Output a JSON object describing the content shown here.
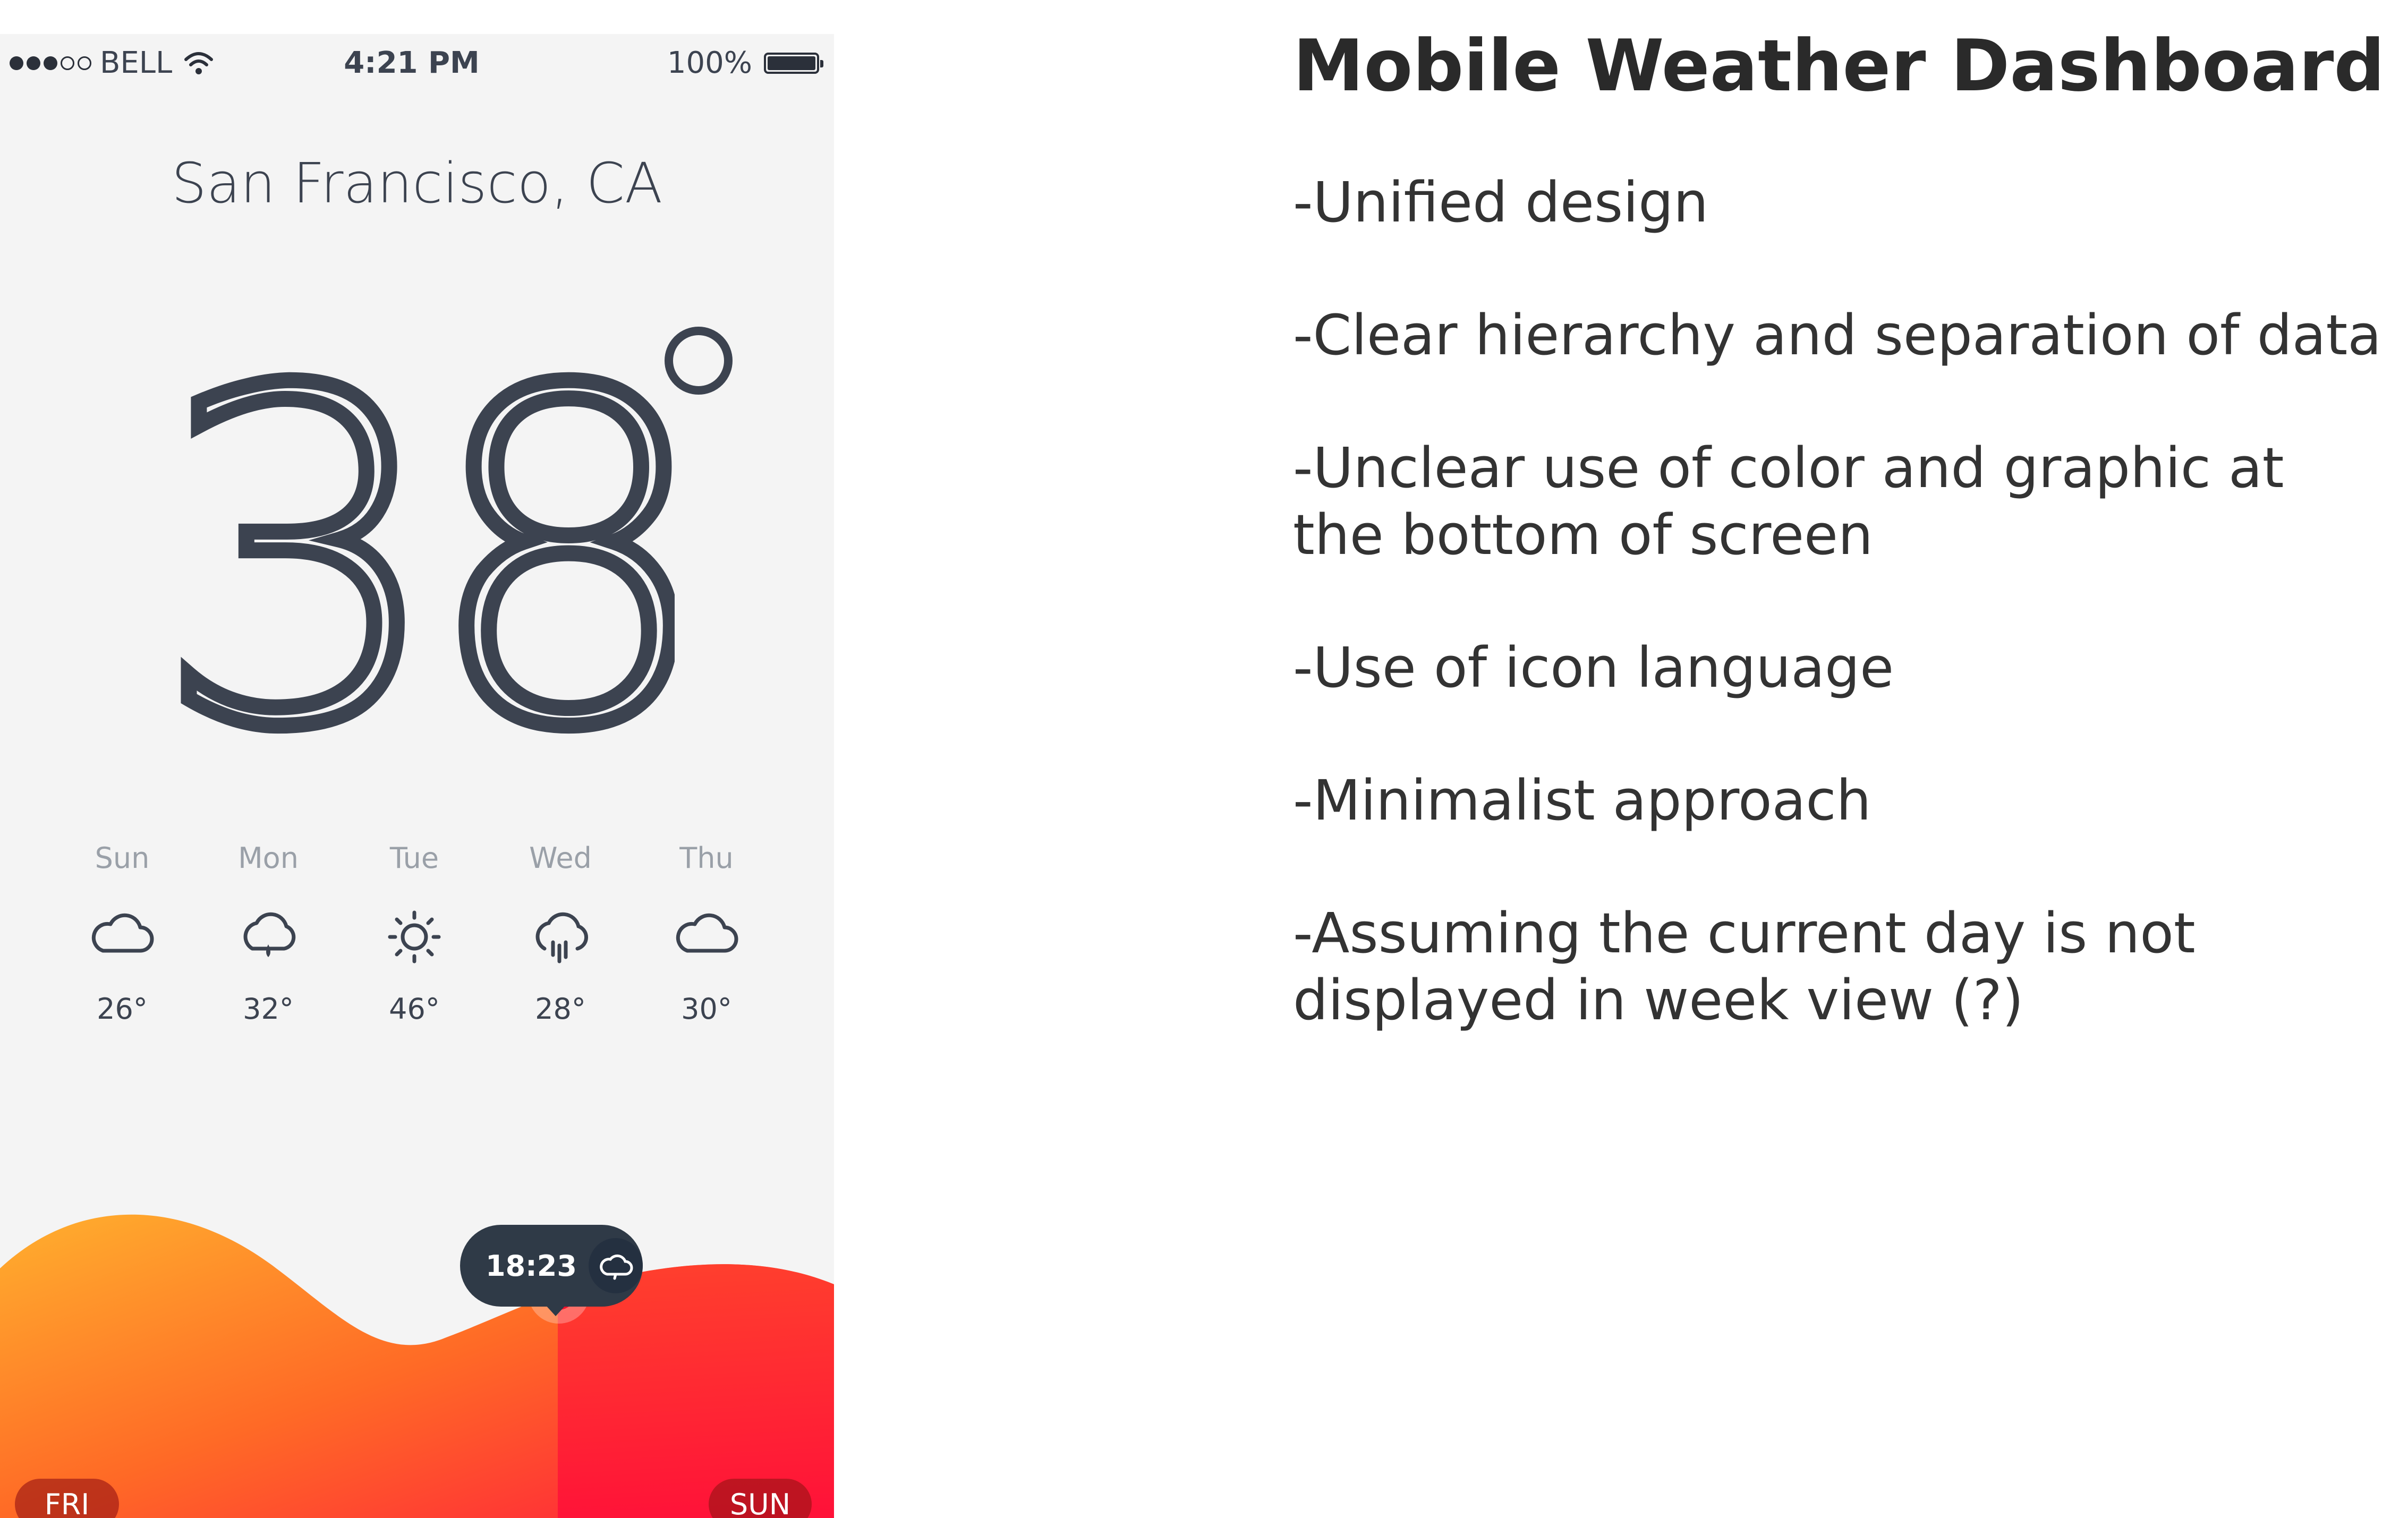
{
  "phone": {
    "status_bar": {
      "carrier": "BELL",
      "time": "4:21 PM",
      "battery": "100%",
      "signal_bars": 3,
      "signal_max": 5
    },
    "city": "San Francisco, CA",
    "current_temp": "38",
    "forecast": [
      {
        "day": "Sun",
        "icon": "cloud-icon",
        "temp": "26°"
      },
      {
        "day": "Mon",
        "icon": "cloud-rain-drop-icon",
        "temp": "32°"
      },
      {
        "day": "Tue",
        "icon": "sun-icon",
        "temp": "46°"
      },
      {
        "day": "Wed",
        "icon": "cloud-heavy-rain-icon",
        "temp": "28°"
      },
      {
        "day": "Thu",
        "icon": "cloud-icon",
        "temp": "30°"
      }
    ],
    "timeline": {
      "tooltip_time": "18:23",
      "tooltip_icon": "cloud-icon",
      "start_label": "FRI",
      "end_label": "SUN"
    },
    "colors": {
      "background": "#f4f4f4",
      "text_dark": "#3c4350",
      "gradient_start": "#ffb02e",
      "gradient_end": "#ff1a3c",
      "marker": "#f0102c",
      "tooltip_bg": "#2f3a47"
    }
  },
  "notes": {
    "title": "Mobile Weather Dashboard",
    "items": [
      "-Unified design",
      "-Clear hierarchy and separation of data",
      "-Unclear use of color and graphic at the bottom of screen",
      "-Use of icon language",
      "-Minimalist approach",
      "-Assuming the current day is not displayed in week view (?)"
    ]
  }
}
